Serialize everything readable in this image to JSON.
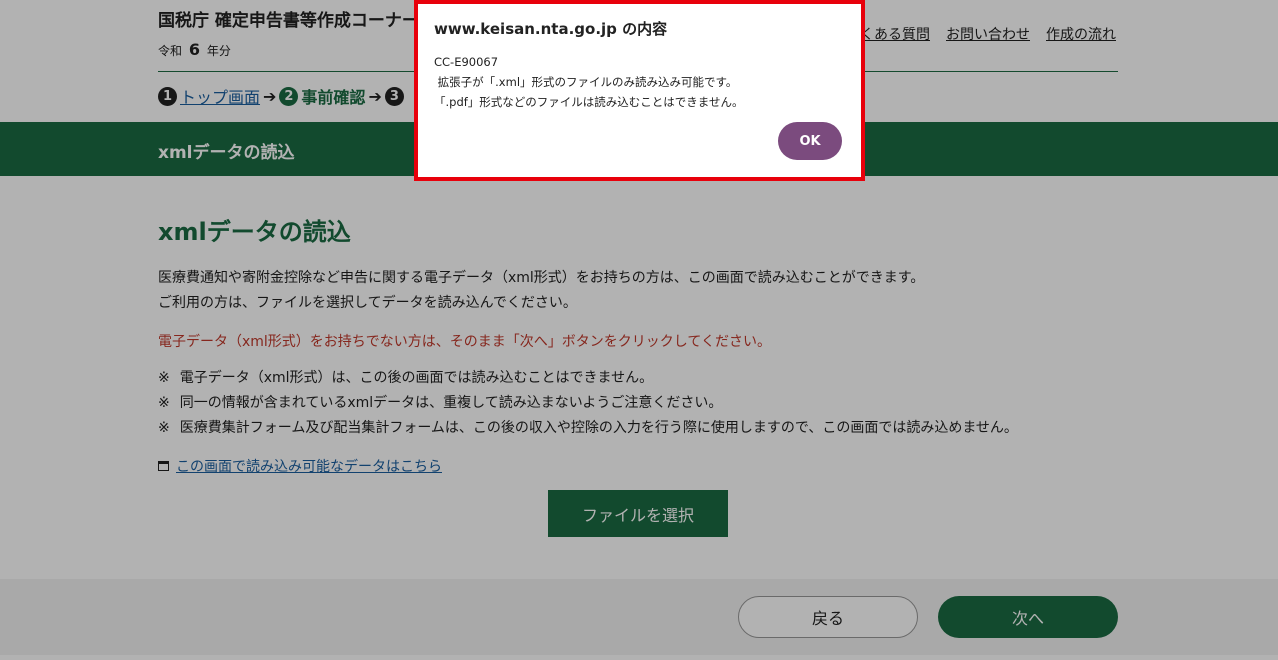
{
  "header": {
    "title": "国税庁 確定申告書等作成コーナー",
    "year_prefix": "令和",
    "year_number": "6",
    "year_suffix": "年分",
    "links": [
      "よくある質問",
      "お問い合わせ",
      "作成の流れ"
    ]
  },
  "steps": [
    {
      "num": "1",
      "label": "トップ画面"
    },
    {
      "num": "2",
      "label": "事前確認"
    },
    {
      "num": "3",
      "label": ""
    }
  ],
  "steps_arrow": "➔",
  "band": {
    "title": "xmlデータの読込"
  },
  "main": {
    "title": "xmlデータの読込",
    "para_lines": [
      "医療費通知や寄附金控除など申告に関する電子データ（xml形式）をお持ちの方は、この画面で読み込むことができます。",
      "ご利用の方は、ファイルを選択してデータを読み込んでください。"
    ],
    "red_notice": "電子データ（xml形式）をお持ちでない方は、そのまま「次へ」ボタンをクリックしてください。",
    "note_mark": "※",
    "notes": [
      "電子データ（xml形式）は、この後の画面では読み込むことはできません。",
      "同一の情報が含まれているxmlデータは、重複して読み込まないようご注意ください。",
      "医療費集計フォーム及び配当集計フォームは、この後の収入や控除の入力を行う際に使用しますので、この画面では読み込めません。"
    ],
    "help_link": "この画面で読み込み可能なデータはこちら",
    "file_button": "ファイルを選択"
  },
  "footer": {
    "back_label": "戻る",
    "next_label": "次へ"
  },
  "dialog": {
    "title": "www.keisan.nta.go.jp の内容",
    "message": "CC-E90067\n 拡張子が「.xml」形式のファイルのみ読み込み可能です。\n「.pdf」形式などのファイルは読み込むことはできません。",
    "ok_label": "OK"
  },
  "colors": {
    "brand_green": "#1a6b42",
    "dialog_border": "#e8000b",
    "ok_button": "#7b4b7e",
    "notice_red": "#c0392b"
  }
}
